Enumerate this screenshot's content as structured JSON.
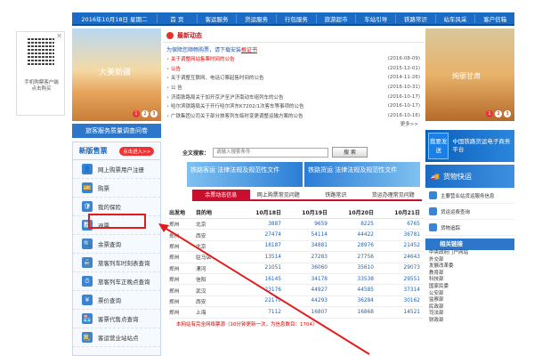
{
  "topbar": {
    "date": "2016年10月18日 星期二",
    "nav": [
      "首  页",
      "客运服务",
      "货运服务",
      "行包服务",
      "旅游超市",
      "车站引导",
      "铁路常识",
      "站车风采",
      "客户信箱"
    ]
  },
  "qr_popup": {
    "caption": "手机购票客户端\n点击购买"
  },
  "banner_left": {
    "label": "大美新疆",
    "pages": [
      "1",
      "2",
      "3"
    ]
  },
  "banner_right": {
    "label": "绚丽甘肃",
    "pages": [
      "1",
      "2",
      "3"
    ]
  },
  "survey_label": "旅客服务质量调查问卷",
  "news": {
    "title": "最新动态",
    "notice": "为保障您顺畅购票，请下载安装",
    "notice_link": "根证书",
    "items": [
      {
        "title": "关于调整网站售票时间的公告",
        "date": "(2016-08-09)",
        "red": true
      },
      {
        "title": "公告",
        "date": "(2015-12-01)",
        "red": true
      },
      {
        "title": "关于调整互联网、电话订票起售时间的公告",
        "date": "(2014-11-26)",
        "red": false
      },
      {
        "title": "公 告",
        "date": "(2016-10-31)",
        "red": false
      },
      {
        "title": "济南铁路局关于加开京沪至沪济南动车组列车的公告",
        "date": "(2016-10-17)",
        "red": false
      },
      {
        "title": "哈尔滨铁路局关于开行哈尔滨东K7202/1次客车等事项的公告",
        "date": "(2016-10-17)",
        "red": false
      },
      {
        "title": "广铁集团公司关于部分旅客列车临时变更调整运输方案的公告",
        "date": "(2016-10-16)",
        "red": false
      }
    ],
    "more": "更多>>"
  },
  "complain": {
    "badge": "我要发送",
    "text": "中国铁路货运电子商务平台"
  },
  "sidebar": {
    "title": "新版售票",
    "enter": "点击进入>>",
    "items": [
      "网上购票用户注册",
      "购票",
      "我的保险",
      "退票",
      "余票查询",
      "旅客列车时刻表查询",
      "旅客列车正晚点查询",
      "票价查询",
      "客票代售点查询",
      "客运营业站站点"
    ]
  },
  "search": {
    "label": "全文搜索：",
    "placeholder": "请输入搜索条件",
    "button": "搜 索"
  },
  "ads": [
    "铁路客运 法律法规及规范性文件",
    "铁路货运 法律法规及规范性文件"
  ],
  "tabs": [
    "余票动态信息",
    "网上购票常见问题",
    "铁路常识",
    "货运办理常见问题"
  ],
  "ticket_table": {
    "headers": [
      "出发地",
      "目的地",
      "10月18日",
      "10月19日",
      "10月20日",
      "10月21日"
    ],
    "rows": [
      [
        "郑州",
        "北京",
        "3887",
        "9659",
        "8225",
        "6765"
      ],
      [
        "郑州",
        "西安",
        "27474",
        "54114",
        "44422",
        "36781"
      ],
      [
        "郑州",
        "北京",
        "18187",
        "34881",
        "28976",
        "21452"
      ],
      [
        "郑州",
        "驻马店",
        "13514",
        "27283",
        "27756",
        "24643"
      ],
      [
        "郑州",
        "漯河",
        "21051",
        "36060",
        "35610",
        "29073"
      ],
      [
        "郑州",
        "信阳",
        "16145",
        "34178",
        "33538",
        "29551"
      ],
      [
        "郑州",
        "武汉",
        "23176",
        "44927",
        "44585",
        "37314"
      ],
      [
        "郑州",
        "西安",
        "22170",
        "44293",
        "36284",
        "30162"
      ],
      [
        "郑州",
        "上海",
        "7112",
        "16807",
        "16868",
        "14521"
      ]
    ],
    "footer": "本网站有完全网络票源（10分钟更新一次，为信息数目：1704）",
    "more": "更多余票>>"
  },
  "right_panel": {
    "goods": "货物快运",
    "services": [
      "主要营业站货运服务信息",
      "货运运费查询",
      "货物追踪"
    ],
    "links_title": "相关链接",
    "links": [
      "中央政府门户网站",
      "外交部",
      "发展改革委",
      "教育部",
      "科技部",
      "国家民委",
      "公安部",
      "监察部",
      "民政部",
      "司法部",
      "财政部"
    ]
  },
  "colors": {
    "brand": "#1b6bc4",
    "accent": "#c8102e",
    "highlight": "#e21c1c"
  }
}
